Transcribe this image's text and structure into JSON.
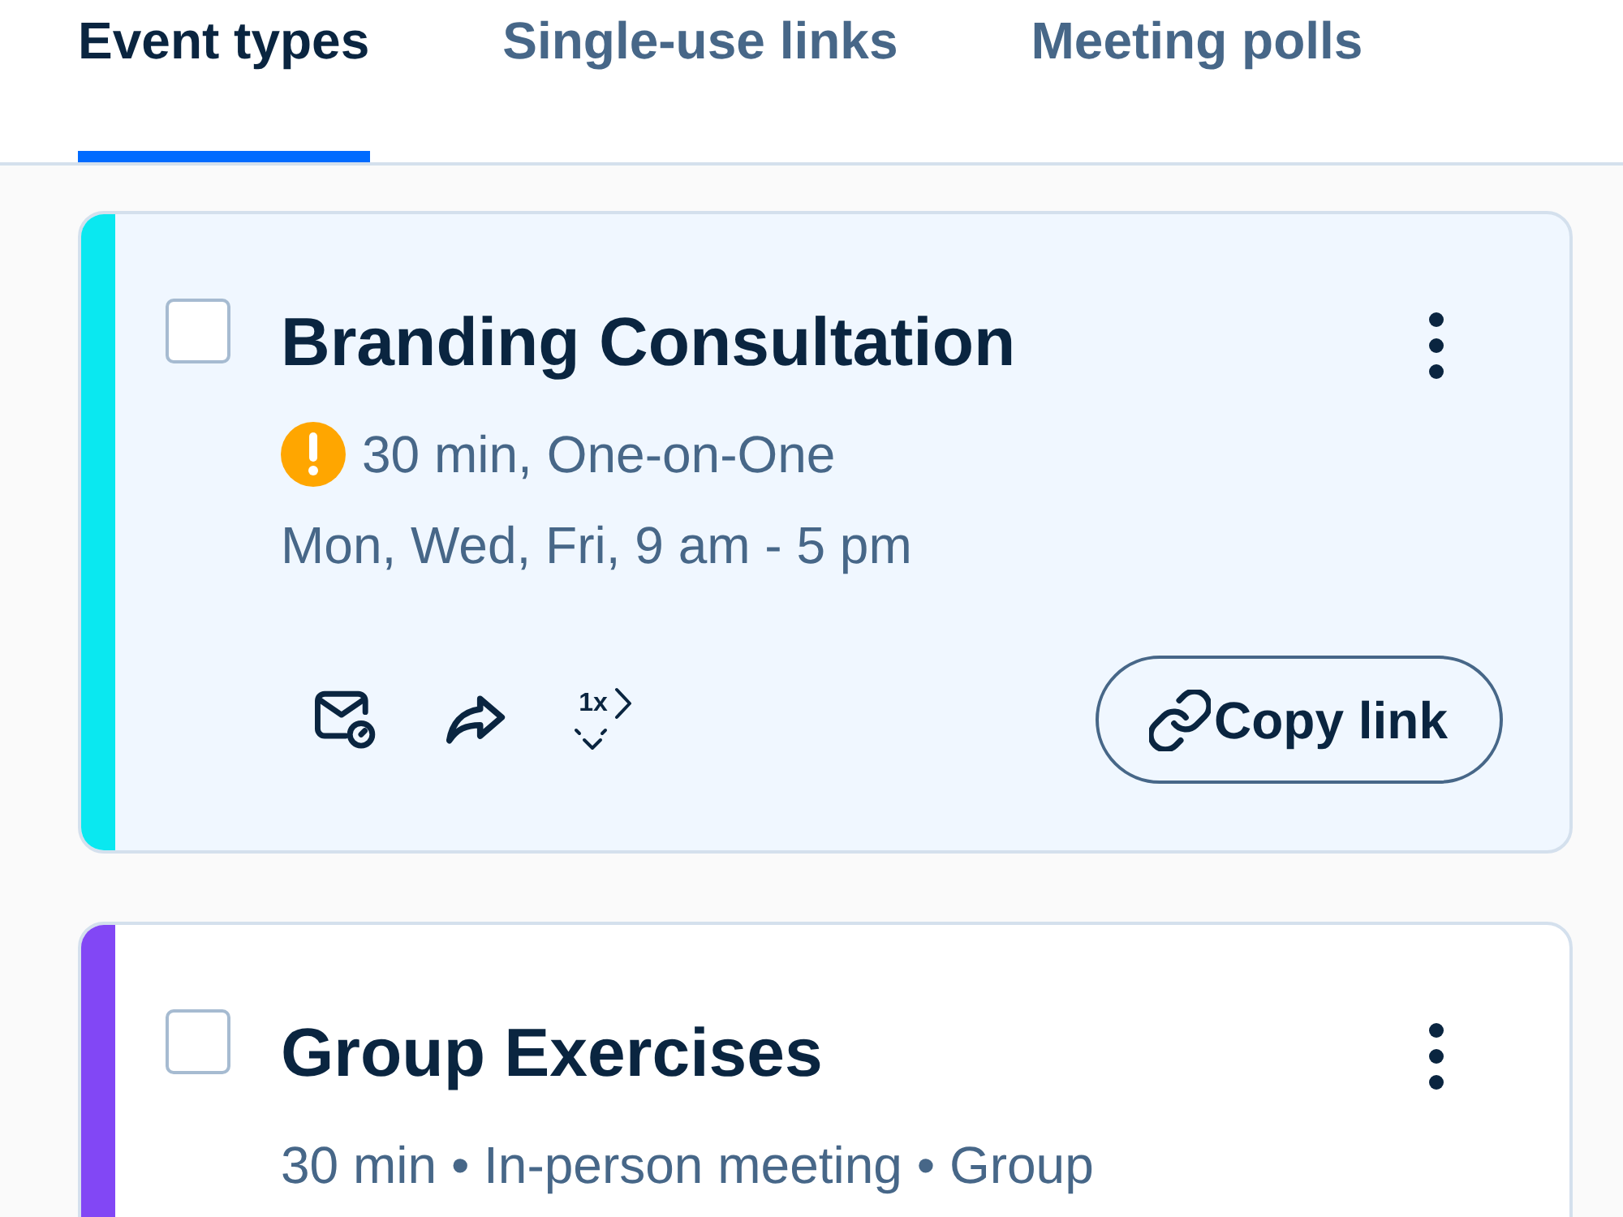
{
  "tabs": [
    {
      "label": "Event types",
      "selected": true
    },
    {
      "label": "Single-use links",
      "selected": false
    },
    {
      "label": "Meeting polls",
      "selected": false
    }
  ],
  "cards": [
    {
      "title": "Branding Consultation",
      "color": "#0ae8f0",
      "highlighted": true,
      "checked": false,
      "lines": [
        {
          "text": "30 min, One-on-One",
          "warning": true
        },
        {
          "text": "Mon, Wed, Fri, 9 am - 5 pm",
          "warning": false
        }
      ],
      "actions": {
        "icon_buttons": [
          {
            "kind": "email"
          },
          {
            "kind": "share"
          },
          {
            "kind": "single",
            "label": "1x"
          }
        ],
        "copy_button": "Copy link"
      }
    },
    {
      "title": "Group Exercises",
      "color": "#8247f5",
      "highlighted": false,
      "checked": false,
      "lines": [
        {
          "text": "30 min • In-person meeting • Group",
          "warning": false
        }
      ]
    }
  ]
}
